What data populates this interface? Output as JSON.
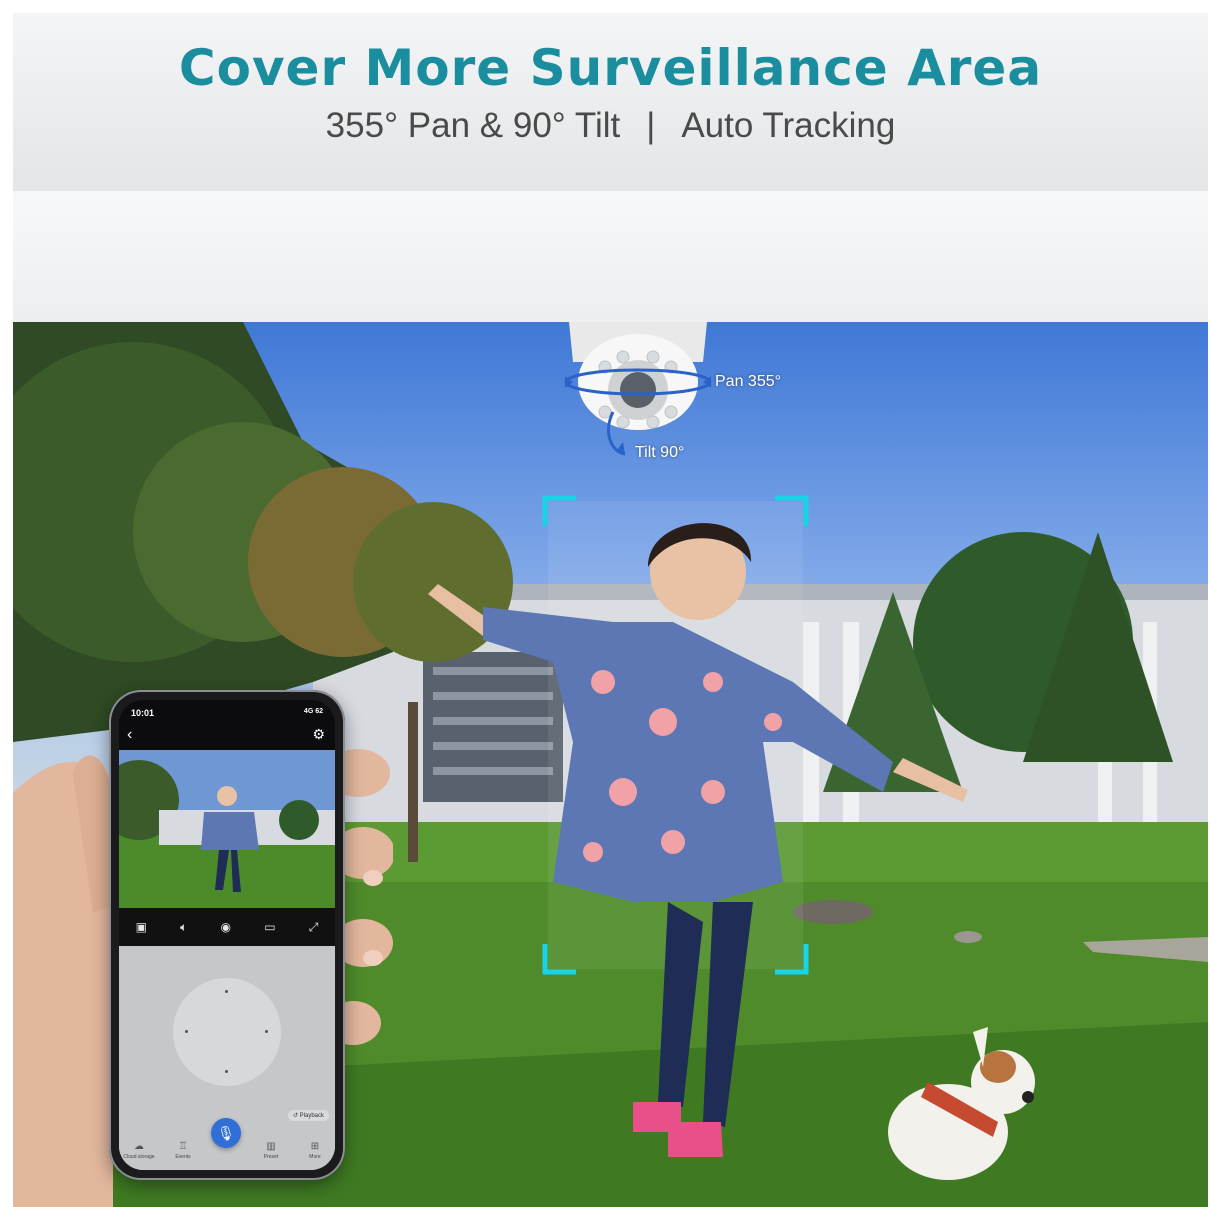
{
  "header": {
    "title": "Cover More Surveillance Area",
    "subtitle_left": "355° Pan & 90° Tilt",
    "subtitle_sep": "|",
    "subtitle_right": "Auto Tracking"
  },
  "camera": {
    "pan_label": "Pan 355°",
    "tilt_label": "Tilt 90°"
  },
  "colors": {
    "title": "#1a8e9e",
    "tracking_box": "#19d3e6",
    "arrow": "#2a62c9",
    "app_accent": "#2f6fd6"
  },
  "phone": {
    "time": "10:01",
    "status_right": "4G 62",
    "icons": {
      "back": "back-icon",
      "settings": "gear-icon",
      "toolbar": [
        "hd-icon",
        "speaker-icon",
        "camera-icon",
        "record-icon",
        "fullscreen-icon"
      ]
    },
    "playback_label": "Playback",
    "bottom_nav": [
      "Cloud storage",
      "Events",
      "Preset",
      "More"
    ]
  }
}
